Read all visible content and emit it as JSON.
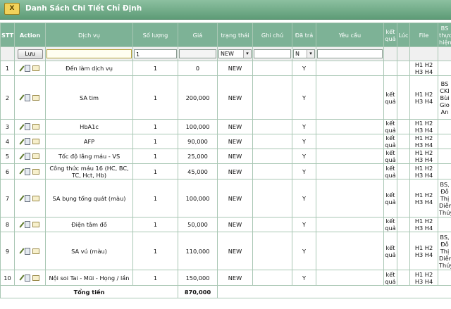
{
  "window": {
    "title": "Danh Sách Chi Tiết Chỉ Định",
    "close_label": "X"
  },
  "headers": {
    "stt": "STT",
    "action": "Action",
    "service": "Dịch vụ",
    "qty": "Số lượng",
    "price": "Giá",
    "status": "trạng thái",
    "note": "Ghi chú",
    "paid": "Đã trả",
    "request": "Yêu cầu",
    "result": "kết quả",
    "time": "Lúc",
    "file": "File",
    "doctor": "BS thực hiện"
  },
  "filter": {
    "save_label": "Lưu",
    "qty_value": "1",
    "status_value": "NEW",
    "paid_value": "N"
  },
  "rows": [
    {
      "stt": "1",
      "service": "Đến làm dịch vụ",
      "qty": "1",
      "price": "0",
      "status": "NEW",
      "paid": "Y",
      "result": "",
      "file": "H1 H2 H3 H4",
      "doctor": ""
    },
    {
      "stt": "2",
      "service": "SA tim",
      "qty": "1",
      "price": "200,000",
      "status": "NEW",
      "paid": "Y",
      "result": "kết quả",
      "file": "H1 H2 H3 H4",
      "doctor": "BS CKI Bùi Gio An"
    },
    {
      "stt": "3",
      "service": "HbA1c",
      "qty": "1",
      "price": "100,000",
      "status": "NEW",
      "paid": "Y",
      "result": "kết quả",
      "file": "H1 H2 H3 H4",
      "doctor": ""
    },
    {
      "stt": "4",
      "service": "AFP",
      "qty": "1",
      "price": "90,000",
      "status": "NEW",
      "paid": "Y",
      "result": "kết quả",
      "file": "H1 H2 H3 H4",
      "doctor": ""
    },
    {
      "stt": "5",
      "service": "Tốc độ lắng máu - VS",
      "qty": "1",
      "price": "25,000",
      "status": "NEW",
      "paid": "Y",
      "result": "kết quả",
      "file": "H1 H2 H3 H4",
      "doctor": ""
    },
    {
      "stt": "6",
      "service": "Công thức máu 16 (HC, BC, TC, Hct, Hb)",
      "qty": "1",
      "price": "45,000",
      "status": "NEW",
      "paid": "Y",
      "result": "kết quả",
      "file": "H1 H2 H3 H4",
      "doctor": ""
    },
    {
      "stt": "7",
      "service": "SA bụng tổng quát (màu)",
      "qty": "1",
      "price": "100,000",
      "status": "NEW",
      "paid": "Y",
      "result": "kết quả",
      "file": "H1 H2 H3 H4",
      "doctor": "BS, Đỗ Thị Diễm Thúy"
    },
    {
      "stt": "8",
      "service": "Điện tâm đồ",
      "qty": "1",
      "price": "50,000",
      "status": "NEW",
      "paid": "Y",
      "result": "kết quả",
      "file": "H1 H2 H3 H4",
      "doctor": ""
    },
    {
      "stt": "9",
      "service": "SA vú (màu)",
      "qty": "1",
      "price": "110,000",
      "status": "NEW",
      "paid": "Y",
      "result": "kết quả",
      "file": "H1 H2 H3 H4",
      "doctor": "BS, Đỗ Thị Diễm Thúy"
    },
    {
      "stt": "10",
      "service": "Nội soi Tai - Mũi - Họng / lần",
      "qty": "1",
      "price": "150,000",
      "status": "NEW",
      "paid": "Y",
      "result": "kết quả",
      "file": "H1 H2 H3 H4",
      "doctor": ""
    }
  ],
  "total": {
    "label": "Tổng tiền",
    "value": "870,000"
  },
  "colors": {
    "header": "#7db296",
    "titlebar": "#6aa682",
    "border": "#a9c7b4",
    "close": "#f1d25a"
  }
}
